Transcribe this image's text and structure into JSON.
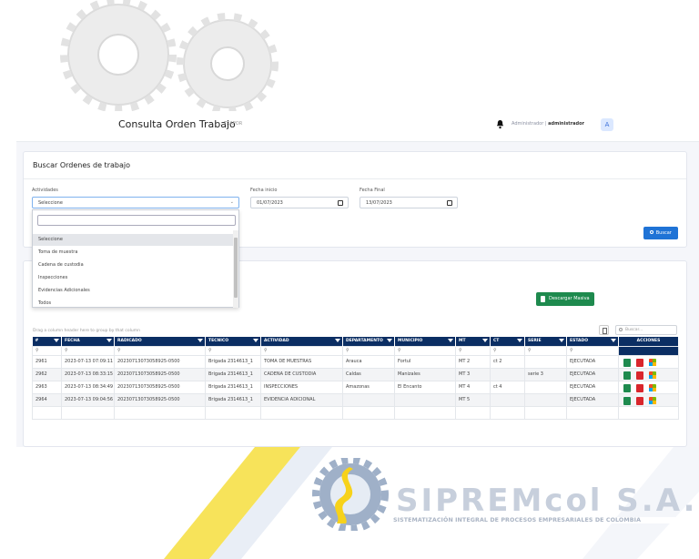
{
  "header": {
    "title": "Consulta Orden Trabajo",
    "subtitle": "TRAPOR",
    "user_role": "Administrador |",
    "user_name": "administrador",
    "avatar_letter": "A"
  },
  "search_card": {
    "title": "Buscar Ordenes de trabajo",
    "actividades_label": "Actividades",
    "actividades_value": "Seleccione",
    "fecha_inicio_label": "Fecha inicio",
    "fecha_inicio_value": "01/07/2023",
    "fecha_final_label": "Fecha Final",
    "fecha_final_value": "13/07/2023",
    "buscar_button": "Buscar"
  },
  "dropdown": {
    "options": [
      "Seleccione",
      "Toma de muestra",
      "Cadena de custodia",
      "Inspecciones",
      "Evidencias Adicionales",
      "Todos"
    ],
    "selected": "Seleccione"
  },
  "results": {
    "download_button": "Descargar Masiva",
    "group_hint": "Drag a column header here to group by that column",
    "search_placeholder": "Buscar...",
    "columns": [
      "#",
      "FECHA",
      "RADICADO",
      "TECNICO",
      "ACTIVIDAD",
      "DEPARTAMENTO",
      "MUNICIPIO",
      "MT",
      "CT",
      "SERIE",
      "ESTADO",
      "ACCIONES"
    ],
    "rows": [
      [
        "2961",
        "2023-07-13 07:09:11",
        "20230713073058925-0500",
        "Brigada 2314613_1",
        "TOMA DE MUESTRAS",
        "Arauca",
        "Fortul",
        "MT 2",
        "ct 2",
        "",
        "EJECUTADA"
      ],
      [
        "2962",
        "2023-07-13 08:33:15",
        "20230713073058925-0500",
        "Brigada 2314613_1",
        "CADENA DE CUSTODIA",
        "Caldas",
        "Manizales",
        "MT 3",
        "",
        "serie 3",
        "EJECUTADA"
      ],
      [
        "2963",
        "2023-07-13 08:34:49",
        "20230713073058925-0500",
        "Brigada 2314613_1",
        "INSPECCIONES",
        "Amazonas",
        "El Encanto",
        "MT 4",
        "ct 4",
        "",
        "EJECUTADA"
      ],
      [
        "2964",
        "2023-07-13 09:04:56",
        "20230713073058925-0500",
        "Brigada 2314613_1",
        "EVIDENCIA ADICIONAL",
        "",
        "",
        "MT 5",
        "",
        "",
        "EJECUTADA"
      ]
    ]
  },
  "footer": {
    "brand": "SIPREMcol S.A.S",
    "tagline": "SISTEMATIZACIÓN INTEGRAL DE PROCESOS EMPRESARIALES DE COLOMBIA"
  },
  "colors": {
    "primary": "#1f73d6",
    "success": "#1e8a4e",
    "grid_header": "#0b2e63",
    "accent_yellow": "#f7d21a"
  }
}
